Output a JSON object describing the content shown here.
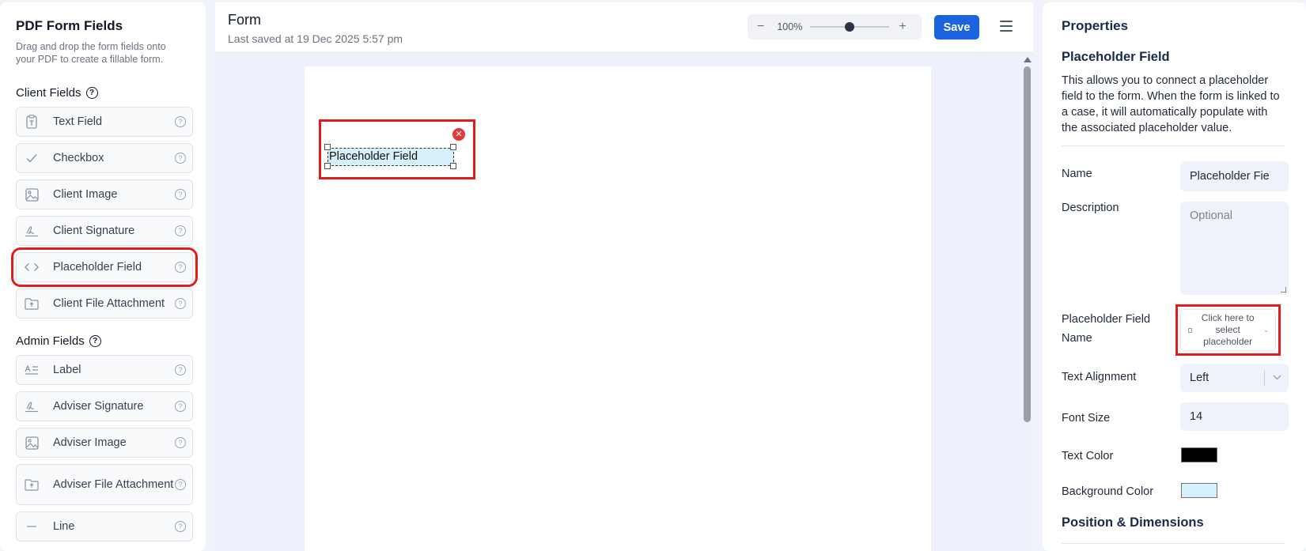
{
  "sidebar": {
    "title": "PDF Form Fields",
    "subtitle": "Drag and drop the form fields onto your PDF to create a fillable form.",
    "client_section": "Client Fields",
    "admin_section": "Admin Fields",
    "client_fields": [
      {
        "label": "Text Field",
        "icon": "text-field-icon"
      },
      {
        "label": "Checkbox",
        "icon": "checkmark-icon"
      },
      {
        "label": "Client Image",
        "icon": "image-icon"
      },
      {
        "label": "Client Signature",
        "icon": "signature-icon"
      },
      {
        "label": "Placeholder Field",
        "icon": "code-brackets-icon"
      },
      {
        "label": "Client File Attachment",
        "icon": "folder-upload-icon"
      }
    ],
    "admin_fields": [
      {
        "label": "Label",
        "icon": "label-icon"
      },
      {
        "label": "Adviser Signature",
        "icon": "signature-icon"
      },
      {
        "label": "Adviser Image",
        "icon": "image-icon"
      },
      {
        "label": "Adviser File Attachment",
        "icon": "folder-upload-icon"
      },
      {
        "label": "Line",
        "icon": "line-icon"
      }
    ]
  },
  "header": {
    "title": "Form",
    "last_saved": "Last saved at 19 Dec 2025 5:57 pm",
    "zoom_level": "100%",
    "zoom_fraction": 0.5,
    "save_label": "Save"
  },
  "canvas": {
    "field_label": "Placeholder Field"
  },
  "properties": {
    "title": "Properties",
    "field_type": "Placeholder Field",
    "description": "This allows you to connect a placeholder field to the form. When the form is linked to a case, it will automatically populate with the associated placeholder value.",
    "name_label": "Name",
    "name_value": "Placeholder Fie",
    "description_label": "Description",
    "description_placeholder": "Optional",
    "placeholder_name_label_1": "Placeholder Field",
    "placeholder_name_label_2": "Name",
    "placeholder_select_text": "Click here to select placeholder",
    "alignment_label": "Text Alignment",
    "alignment_value": "Left",
    "font_size_label": "Font Size",
    "font_size_value": "14",
    "text_color_label": "Text Color",
    "text_color": "#000000",
    "bg_color_label": "Background Color",
    "bg_color": "#d6f1fb",
    "position_heading": "Position & Dimensions"
  },
  "colors": {
    "accent": "#1b63e0",
    "highlight": "#e01e1e",
    "delete": "#e23a3a"
  }
}
